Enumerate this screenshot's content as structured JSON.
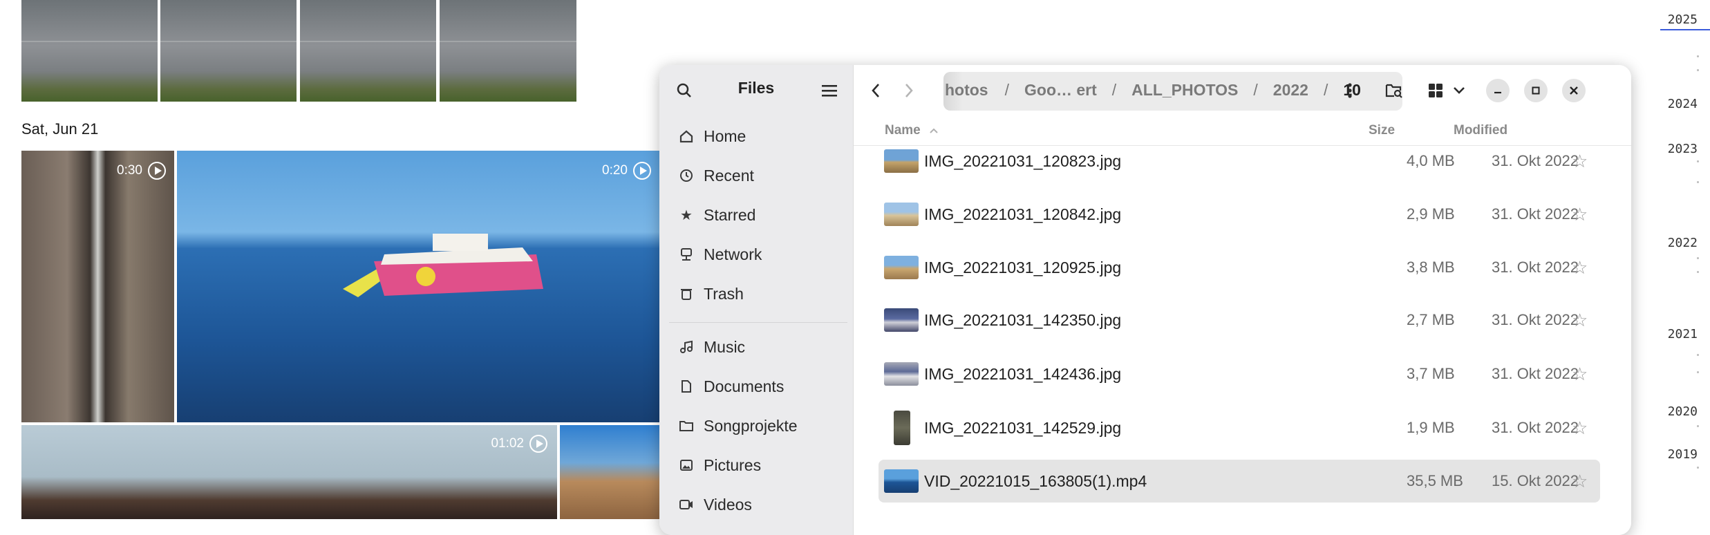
{
  "gallery": {
    "date_header": "Sat, Jun 21",
    "durations": [
      "0:30",
      "0:20",
      "01:02"
    ]
  },
  "timeline": {
    "years": [
      "2025",
      "2024",
      "2023",
      "2022",
      "2021",
      "2020",
      "2019"
    ]
  },
  "files": {
    "title": "Files",
    "sidebar": {
      "items": [
        {
          "label": "Home",
          "icon": "home-icon"
        },
        {
          "label": "Recent",
          "icon": "clock-icon"
        },
        {
          "label": "Starred",
          "icon": "star-icon"
        },
        {
          "label": "Network",
          "icon": "network-icon"
        },
        {
          "label": "Trash",
          "icon": "trash-icon"
        },
        {
          "label": "Music",
          "icon": "music-icon"
        },
        {
          "label": "Documents",
          "icon": "document-icon"
        },
        {
          "label": "Songprojekte",
          "icon": "folder-icon"
        },
        {
          "label": "Pictures",
          "icon": "picture-icon"
        },
        {
          "label": "Videos",
          "icon": "video-icon"
        }
      ]
    },
    "breadcrumb": [
      "hotos",
      "Goo… ert",
      "ALL_PHOTOS",
      "2022",
      "10"
    ],
    "columns": {
      "name": "Name",
      "size": "Size",
      "modified": "Modified"
    },
    "rows": [
      {
        "name": "IMG_20221031_120823.jpg",
        "size": "4,0 MB",
        "modified": "31. Okt 2022"
      },
      {
        "name": "IMG_20221031_120842.jpg",
        "size": "2,9 MB",
        "modified": "31. Okt 2022"
      },
      {
        "name": "IMG_20221031_120925.jpg",
        "size": "3,8 MB",
        "modified": "31. Okt 2022"
      },
      {
        "name": "IMG_20221031_142350.jpg",
        "size": "2,7 MB",
        "modified": "31. Okt 2022"
      },
      {
        "name": "IMG_20221031_142436.jpg",
        "size": "3,7 MB",
        "modified": "31. Okt 2022"
      },
      {
        "name": "IMG_20221031_142529.jpg",
        "size": "1,9 MB",
        "modified": "31. Okt 2022"
      },
      {
        "name": "VID_20221015_163805(1).mp4",
        "size": "35,5 MB",
        "modified": "15. Okt 2022"
      }
    ],
    "selected_row": 6
  },
  "colors": {
    "accent": "#3584e4",
    "selected_row_bg": "#e4e4e4"
  }
}
